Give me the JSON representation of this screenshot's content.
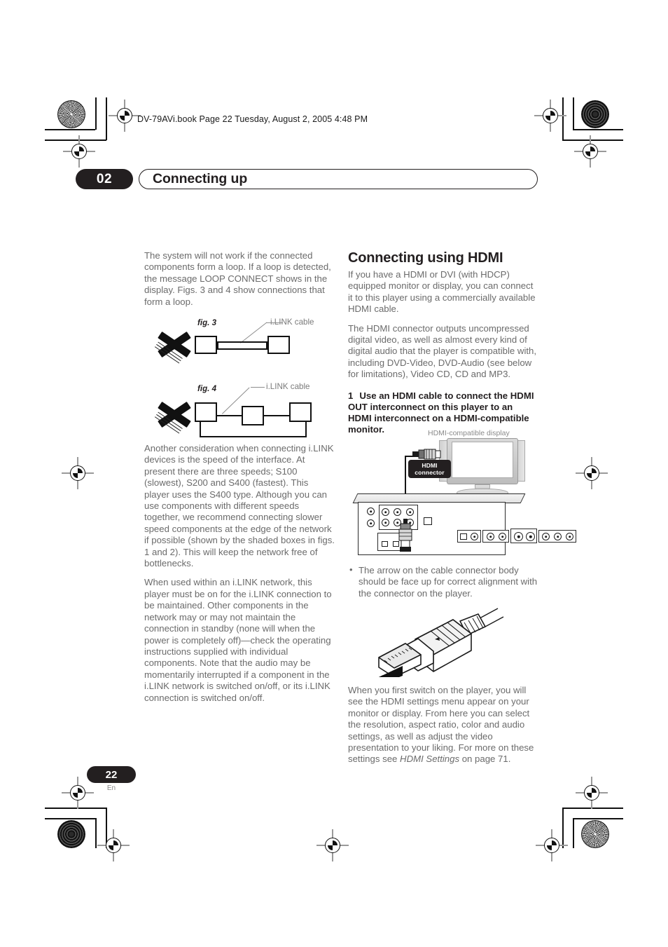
{
  "running_head": "DV-79AVi.book  Page 22  Tuesday, August 2, 2005  4:48 PM",
  "chapter": {
    "number": "02",
    "title": "Connecting up"
  },
  "left_column": {
    "paragraph_1": "The system will not work if the connected components form a loop. If a loop is detected, the message LOOP CONNECT shows in the display. Figs. 3 and 4 show connections that form a loop.",
    "paragraph_2": "Another consideration when connecting i.LINK devices is the speed of the interface. At present there are three speeds; S100 (slowest), S200 and S400 (fastest). This player uses the S400 type. Although you can use components with different speeds together, we recommend connecting slower speed components at the edge of the network if possible (shown by the shaded boxes in figs. 1 and 2). This will keep the network free of bottlenecks.",
    "paragraph_3": "When used within an i.LINK network, this player must be on for the i.LINK connection to be maintained. Other components in the network may or may not maintain the connection in standby (none will when the power is completely off)—check the operating instructions supplied with individual components. Note that the audio may be momentarily interrupted if a component in the i.LINK network is switched on/off, or its i.LINK connection is switched on/off."
  },
  "figures": {
    "fig3": {
      "label": "fig. 3",
      "cable_label": "i.LINK cable",
      "invalid_mark": "x-mark"
    },
    "fig4": {
      "label": "fig. 4",
      "cable_label": "i.LINK cable",
      "invalid_mark": "x-mark"
    }
  },
  "right_column": {
    "heading": "Connecting using HDMI",
    "paragraph_1": "If you have a HDMI or DVI (with HDCP) equipped monitor or display, you can connect it to this player using a commercially available HDMI cable.",
    "paragraph_2": "The HDMI connector outputs uncompressed digital video, as well as almost every kind of digital audio that the player is compatible with, including DVD-Video, DVD-Audio (see below for limitations), Video CD, CD and MP3.",
    "step_1_number": "1",
    "step_1_text": "Use an HDMI cable to connect the HDMI OUT interconnect on this player to an HDMI interconnect on a HDMI-compatible monitor.",
    "bullet_1": "The arrow on the cable connector body should be face up for correct alignment with the connector on the player.",
    "paragraph_3_a": "When you first switch on the player, you will see the HDMI settings menu appear on your monitor or display. From here you can select the resolution, aspect ratio, color and audio settings, as well as adjust the video presentation to your liking. For more on these settings see ",
    "paragraph_3_italic": "HDMI Settings",
    "paragraph_3_b": " on page 71."
  },
  "hdmi_diagram": {
    "display_caption": "HDMI-compatible display",
    "connector_callout_line1": "HDMI",
    "connector_callout_line2": "connector"
  },
  "footer": {
    "page_number": "22",
    "language": "En"
  },
  "colors": {
    "ink_black": "#231f20",
    "body_gray": "#6b6b6b",
    "caption_gray": "#8a8a8a"
  }
}
